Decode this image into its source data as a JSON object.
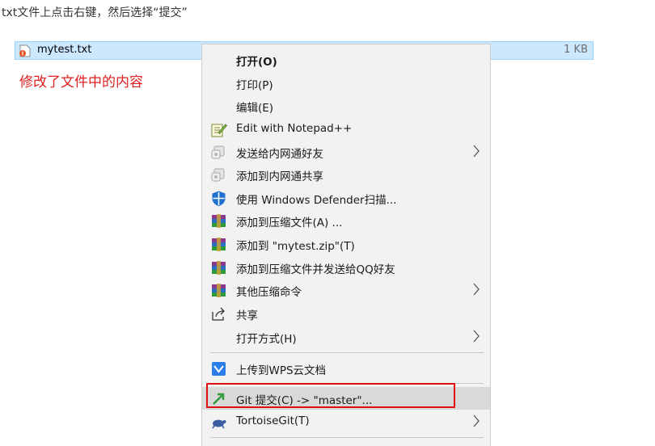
{
  "caption": "txt文件上点击右键，然后选择“提交”",
  "file": {
    "name": "mytest.txt",
    "size": "1 KB",
    "icon": "text-file-icon"
  },
  "note": "修改了文件中的内容",
  "menu": {
    "items": [
      {
        "label": "打开(O)",
        "bold": true
      },
      {
        "label": "打印(P)"
      },
      {
        "label": "编辑(E)"
      },
      {
        "label": "Edit with Notepad++",
        "icon": "notepad-plus-plus-icon"
      },
      {
        "label": "发送给内网通好友",
        "icon": "share-network-icon",
        "submenu": true
      },
      {
        "label": "添加到内网通共享",
        "icon": "share-network-icon"
      },
      {
        "label": "使用 Windows Defender扫描...",
        "icon": "defender-shield-icon"
      },
      {
        "label": "添加到压缩文件(A) ...",
        "icon": "winrar-icon"
      },
      {
        "label": "添加到 \"mytest.zip\"(T)",
        "icon": "winrar-icon"
      },
      {
        "label": "添加到压缩文件并发送给QQ好友",
        "icon": "winrar-icon"
      },
      {
        "label": "其他压缩命令",
        "icon": "winrar-icon",
        "submenu": true
      },
      {
        "label": "共享",
        "icon": "share-icon"
      },
      {
        "label": "打开方式(H)",
        "submenu": true
      },
      {
        "label": "上传到WPS云文档",
        "icon": "wps-cloud-icon"
      },
      {
        "label": "Git 提交(C) -> \"master\"...",
        "icon": "git-commit-icon",
        "highlighted": true
      },
      {
        "label": "TortoiseGit(T)",
        "icon": "tortoisegit-icon",
        "submenu": true
      }
    ]
  },
  "colors": {
    "highlight_box": "#e01010",
    "note_text": "#e02020",
    "selection": "#cce8ff"
  }
}
